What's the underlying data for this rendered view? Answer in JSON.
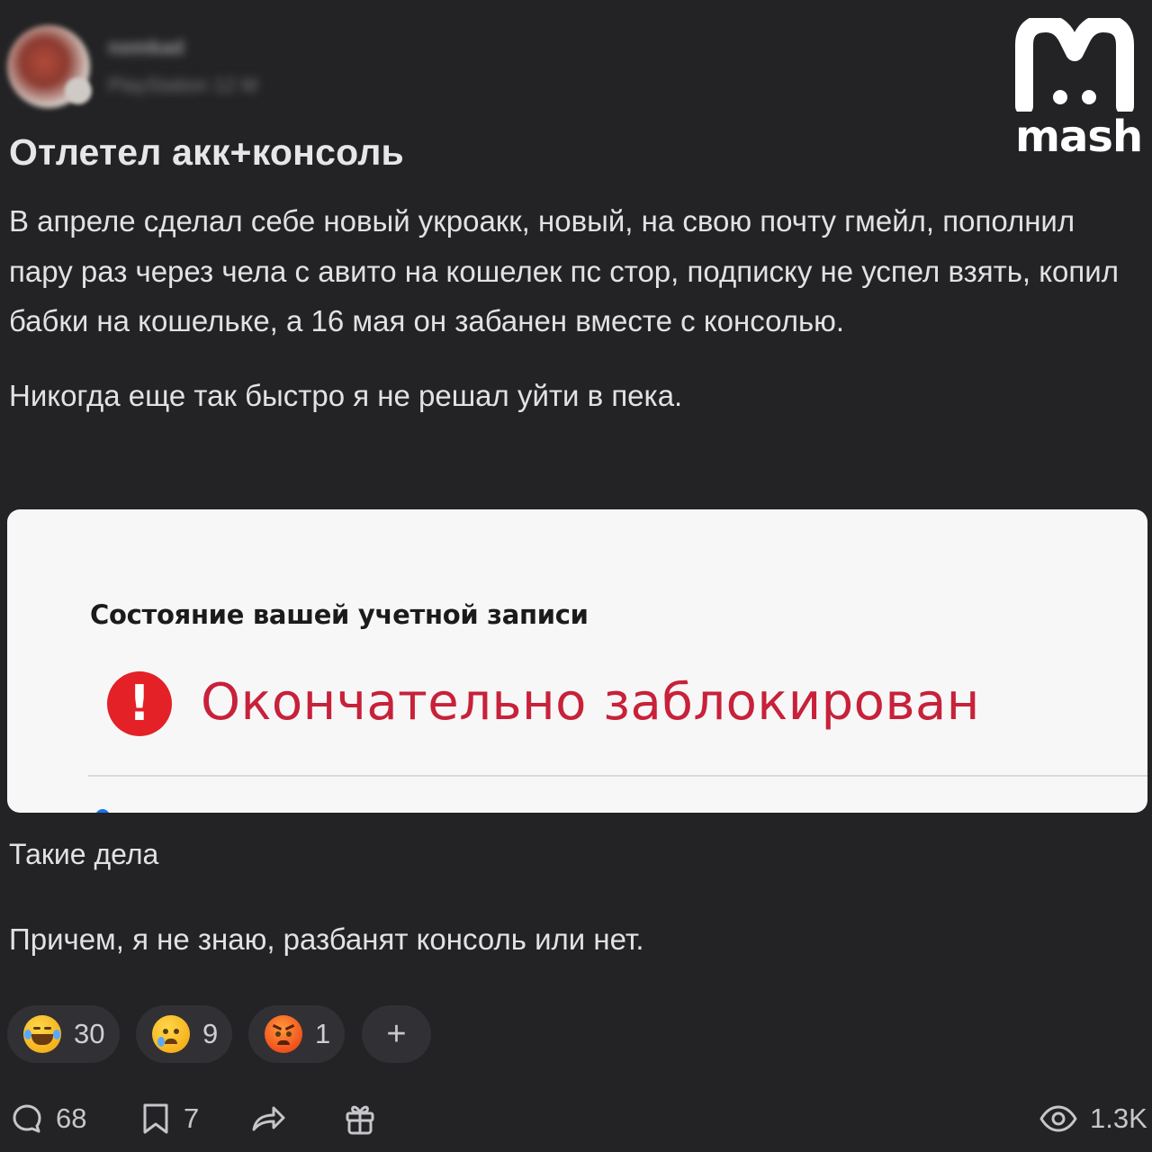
{
  "author": {
    "name": "nomkad",
    "meta": "PlayStation 12 M"
  },
  "brand": {
    "wordmark": "mash",
    "color": "#ffffff"
  },
  "post": {
    "title": "Отлетел акк+консоль",
    "paragraphs": [
      "В апреле сделал себе новый укроакк, новый, на свою почту гмейл, пополнил пару раз через чела с авито на кошелек пс стор, подписку не успел взять, копил бабки на кошельке, а 16 мая он забанен вместе с консолью.",
      "Никогда еще так быстро я не решал уйти в пека."
    ],
    "after_image": [
      "Такие дела",
      "Причем, я не знаю, разбанят консоль или нет."
    ]
  },
  "attachment": {
    "heading": "Состояние вашей учетной записи",
    "alert_icon": "!",
    "status": "Окончательно заблокирован",
    "status_color": "#c8213a",
    "alert_color": "#e32126"
  },
  "reactions": [
    {
      "emoji": "laughing-tears",
      "count": "30"
    },
    {
      "emoji": "crying",
      "count": "9"
    },
    {
      "emoji": "angry",
      "count": "1"
    }
  ],
  "add_reaction_label": "+",
  "actions": {
    "comments": "68",
    "bookmarks": "7",
    "views": "1.3K"
  },
  "colors": {
    "background": "#232325",
    "pill": "#313135",
    "text": "#e2e2e4"
  }
}
